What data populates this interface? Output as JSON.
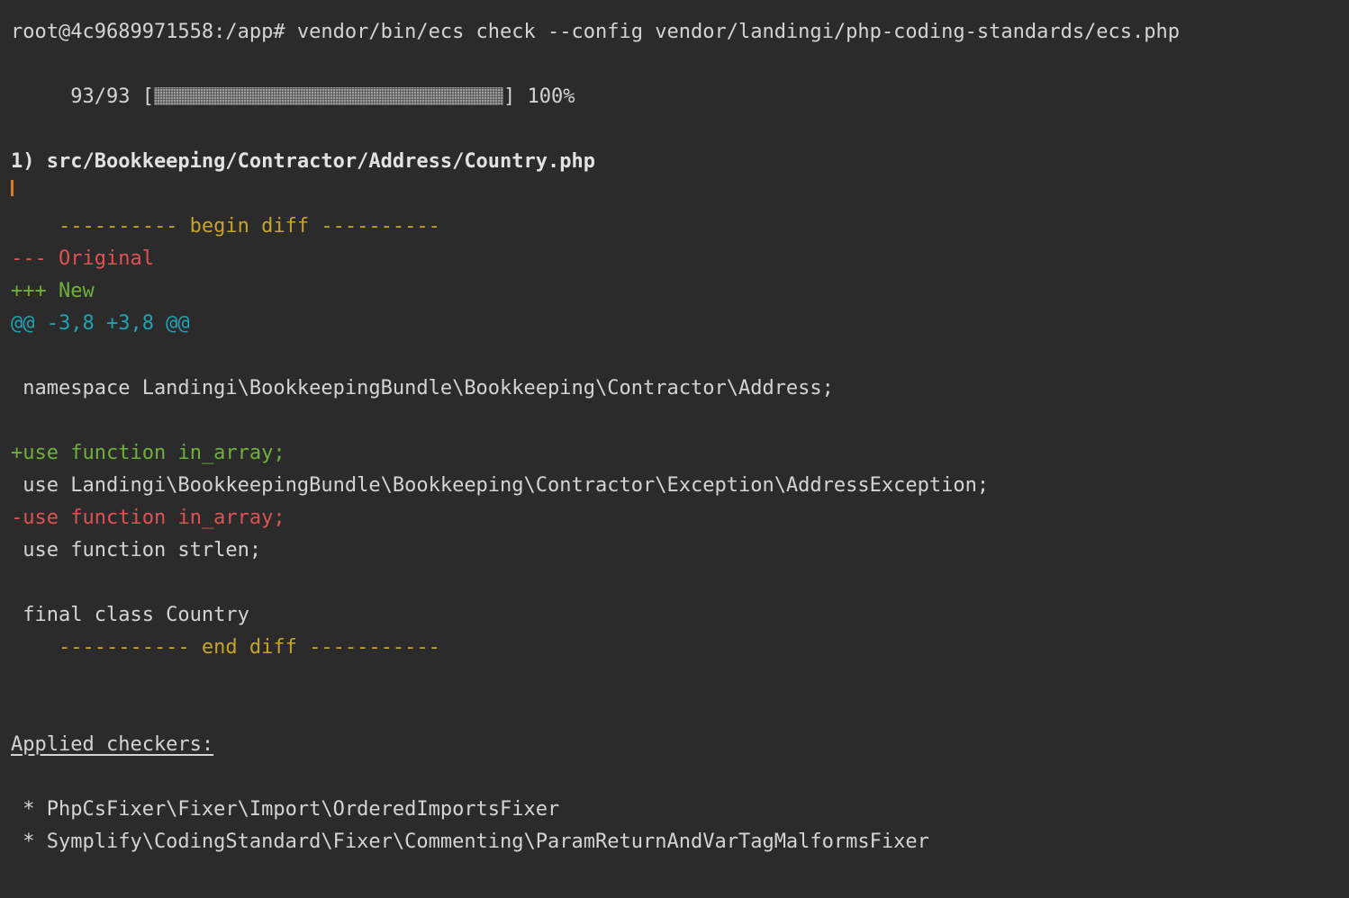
{
  "terminal": {
    "command_line": "root@4c9689971558:/app# vendor/bin/ecs check --config vendor/landingi/php-coding-standards/ecs.php",
    "progress": {
      "count": " 93/93",
      "open_bracket": "[",
      "close_bracket": "]",
      "percent_label": "100%",
      "value": 1.0
    },
    "file_header": "1) src/Bookkeeping/Contractor/Address/Country.php",
    "diff": {
      "begin": "    ---------- begin diff ----------",
      "original": "--- Original",
      "new": "+++ New",
      "hunk": "@@ -3,8 +3,8 @@",
      "namespace_line": " namespace Landingi\\BookkeepingBundle\\Bookkeeping\\Contractor\\Address;",
      "added_prefix": "+",
      "added_keyword": "use",
      "added_rest": " function in_array;",
      "context_use_exception": " use Landingi\\BookkeepingBundle\\Bookkeeping\\Contractor\\Exception\\AddressException;",
      "removed_prefix": "-",
      "removed_keyword": "use",
      "removed_rest": " function in_array;",
      "context_use_strlen": " use function strlen;",
      "class_line": " final class Country",
      "end": "    ----------- end diff -----------"
    },
    "applied_checkers_label": "Applied checkers:",
    "checkers": [
      " * PhpCsFixer\\Fixer\\Import\\OrderedImportsFixer",
      " * Symplify\\CodingStandard\\Fixer\\Commenting\\ParamReturnAndVarTagMalformsFixer"
    ]
  },
  "colors": {
    "background": "#2b2b2b",
    "text": "#d4d4d4",
    "diff_marker": "#c8a32a",
    "removed": "#e05252",
    "added": "#6fb03b",
    "hunk": "#1fa2b3"
  }
}
